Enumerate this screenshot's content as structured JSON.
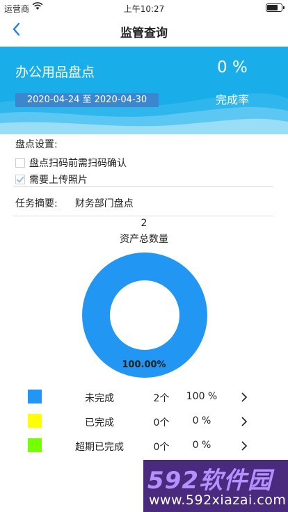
{
  "status_bar": {
    "carrier": "运营商",
    "time": "上午10:27",
    "battery_level": 0.85
  },
  "nav": {
    "title": "监管查询",
    "back_icon": "chevron-left-icon"
  },
  "banner": {
    "task_title": "办公用品盘点",
    "date_range": "2020-04-24 至 2020-04-30",
    "completion_rate": "0 %",
    "completion_label": "完成率"
  },
  "settings": {
    "heading": "盘点设置:",
    "options": [
      {
        "label": "盘点扫码前需扫码确认",
        "checked": false
      },
      {
        "label": "需要上传照片",
        "checked": true
      }
    ]
  },
  "summary": {
    "label": "任务摘要:",
    "value": "财务部门盘点"
  },
  "chart": {
    "total_count": "2",
    "total_label": "资产总数量",
    "center_percent": "100.00%"
  },
  "chart_data": {
    "type": "pie",
    "categories": [
      "未完成",
      "已完成",
      "超期已完成"
    ],
    "values": [
      2,
      0,
      0
    ],
    "colors": [
      "#2196f3",
      "#ffff00",
      "#76ff03"
    ],
    "title": "资产总数量"
  },
  "legend": [
    {
      "name": "未完成",
      "count": "2个",
      "percent": "100 %",
      "color": "#2196f3"
    },
    {
      "name": "已完成",
      "count": "0个",
      "percent": "0 %",
      "color": "#ffff00"
    },
    {
      "name": "超期已完成",
      "count": "0个",
      "percent": "0 %",
      "color": "#76ff03"
    }
  ],
  "watermark": {
    "brand": "592软件园",
    "url": "www.592xiazai.com"
  }
}
